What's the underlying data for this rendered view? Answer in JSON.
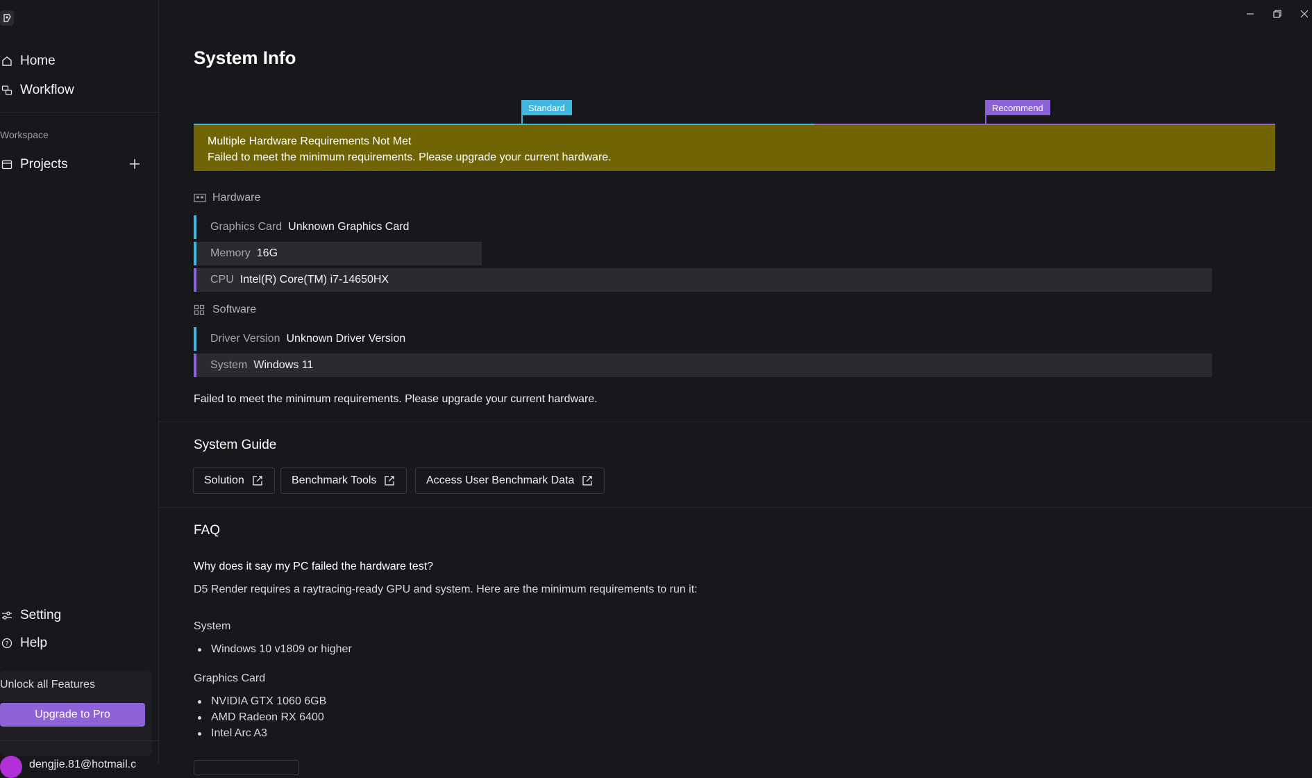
{
  "sidebar": {
    "nav": {
      "home": "Home",
      "workflow": "Workflow"
    },
    "workspace_label": "Workspace",
    "projects": "Projects",
    "setting": "Setting",
    "help": "Help",
    "unlock_text": "Unlock all Features",
    "upgrade_label": "Upgrade to Pro",
    "user_email": "dengjie.81@hotmail.c"
  },
  "page": {
    "title": "System Info"
  },
  "meter": {
    "standard_label": "Standard",
    "recommend_label": "Recommend",
    "standard_color": "#3fb6e0",
    "recommend_color": "#8b63d6"
  },
  "banner": {
    "title": "Multiple Hardware Requirements Not Met",
    "message": "Failed to meet the minimum requirements. Please upgrade your current hardware.",
    "color": "#706405"
  },
  "hardware": {
    "heading": "Hardware",
    "items": [
      {
        "label": "Graphics Card",
        "value": "Unknown Graphics Card"
      },
      {
        "label": "Memory",
        "value": "16G"
      },
      {
        "label": "CPU",
        "value": "Intel(R) Core(TM) i7-14650HX"
      }
    ]
  },
  "software": {
    "heading": "Software",
    "items": [
      {
        "label": "Driver Version",
        "value": "Unknown Driver Version"
      },
      {
        "label": "System",
        "value": "Windows 11"
      }
    ]
  },
  "summary": "Failed to meet the minimum requirements. Please upgrade your current hardware.",
  "guide": {
    "heading": "System Guide",
    "buttons": [
      "Solution",
      "Benchmark Tools",
      "Access User Benchmark Data"
    ]
  },
  "faq": {
    "heading": "FAQ",
    "question": "Why does it say my PC failed the hardware test?",
    "answer": "D5 Render requires a raytracing-ready GPU and system. Here are the minimum requirements to run it:",
    "system_heading": "System",
    "system_items": [
      "Windows 10 v1809 or higher"
    ],
    "gpu_heading": "Graphics Card",
    "gpu_items": [
      "NVIDIA GTX 1060 6GB",
      "AMD Radeon RX 6400",
      "Intel Arc A3"
    ]
  }
}
